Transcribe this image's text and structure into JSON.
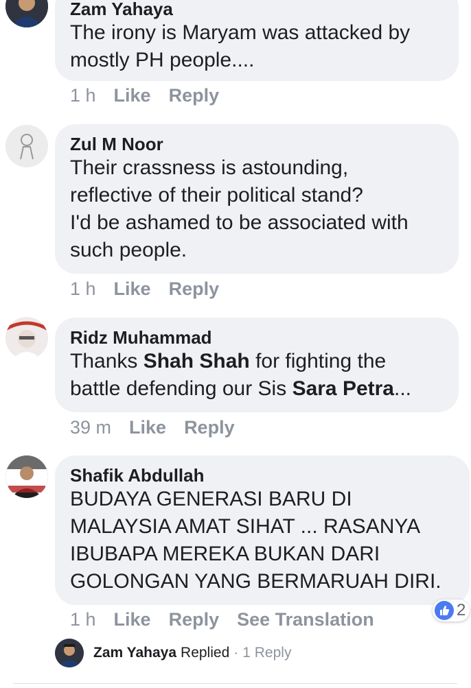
{
  "comments": [
    {
      "name": "Zam Yahaya",
      "lines": [
        "The irony is Maryam was attacked by",
        "mostly PH people...."
      ],
      "time": "1 h",
      "like_label": "Like",
      "reply_label": "Reply"
    },
    {
      "name": "Zul M Noor",
      "lines": [
        "Their crassness is astounding,",
        "reflective of their political stand?",
        "I'd be ashamed to be associated with",
        "such people."
      ],
      "time": "1 h",
      "like_label": "Like",
      "reply_label": "Reply"
    },
    {
      "name": "Ridz Muhammad",
      "line1_pre": "Thanks ",
      "line1_bold": "Shah Shah",
      "line1_post": " for fighting the",
      "line2_pre": "battle defending our Sis ",
      "line2_bold": "Sara Petra",
      "line2_post": "...",
      "time": "39 m",
      "like_label": "Like",
      "reply_label": "Reply"
    },
    {
      "name": "Shafik Abdullah",
      "lines": [
        "BUDAYA GENERASI BARU DI",
        "MALAYSIA AMAT SIHAT ... RASANYA",
        "IBUBAPA MEREKA BUKAN DARI",
        "GOLONGAN YANG BERMARUAH DIRI."
      ],
      "time": "1 h",
      "like_label": "Like",
      "reply_label": "Reply",
      "translate_label": "See Translation",
      "reaction_icon": "thumbs-up-icon",
      "reaction_count": "2"
    }
  ],
  "reply_summary": {
    "name": "Zam Yahaya",
    "action": "Replied",
    "separator": "·",
    "count": "1 Reply"
  },
  "colors": {
    "bubble": "#f0f1f4",
    "meta": "#8d949e",
    "like_blue": "#4b7bf0"
  }
}
